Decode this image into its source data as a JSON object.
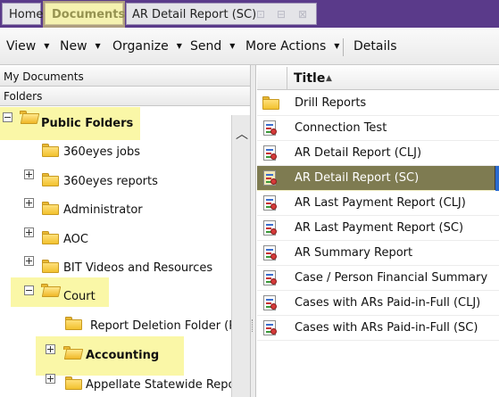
{
  "tabs": {
    "home": "Home",
    "documents": "Documents",
    "report": "AR Detail Report (SC)"
  },
  "toolbar": {
    "view": "View",
    "new": "New",
    "organize": "Organize",
    "send": "Send",
    "more_actions": "More Actions",
    "details": "Details"
  },
  "left_panel": {
    "my_documents": "My Documents",
    "folders": "Folders",
    "tree": [
      {
        "label": "Public Folders",
        "expander": "minus",
        "open": true
      },
      {
        "label": "360eyes jobs",
        "expander": "none"
      },
      {
        "label": "360eyes reports",
        "expander": "plus"
      },
      {
        "label": "Administrator",
        "expander": "plus"
      },
      {
        "label": "AOC",
        "expander": "plus"
      },
      {
        "label": "BIT Videos and Resources",
        "expander": "plus"
      },
      {
        "label": "Court",
        "expander": "minus",
        "open": true
      },
      {
        "label": "Report Deletion Folder (Re",
        "expander": "none"
      },
      {
        "label": "Accounting",
        "expander": "plus",
        "open": true
      },
      {
        "label": "Appellate Statewide Reports",
        "expander": "plus"
      }
    ]
  },
  "right_panel": {
    "column_title": "Title",
    "items": [
      {
        "label": "Drill Reports",
        "type": "folder"
      },
      {
        "label": "Connection Test",
        "type": "report"
      },
      {
        "label": "AR Detail Report (CLJ)",
        "type": "report"
      },
      {
        "label": "AR Detail Report (SC)",
        "type": "report",
        "selected": true
      },
      {
        "label": "AR Last Payment Report (CLJ)",
        "type": "report"
      },
      {
        "label": "AR Last Payment Report (SC)",
        "type": "report"
      },
      {
        "label": "AR Summary Report",
        "type": "report"
      },
      {
        "label": "Case / Person Financial Summary",
        "type": "report"
      },
      {
        "label": "Cases with ARs Paid-in-Full (CLJ)",
        "type": "report"
      },
      {
        "label": "Cases with ARs Paid-in-Full (SC)",
        "type": "report"
      }
    ]
  },
  "icons": {
    "sort": "sort-ascending-icon",
    "folder": "folder-icon",
    "report": "report-icon"
  },
  "colors": {
    "tab_bar": "#5a3a8a",
    "highlight": "#f8f278",
    "selected_row": "#3c3c3c",
    "folder_yellow": "#f2c12e"
  }
}
